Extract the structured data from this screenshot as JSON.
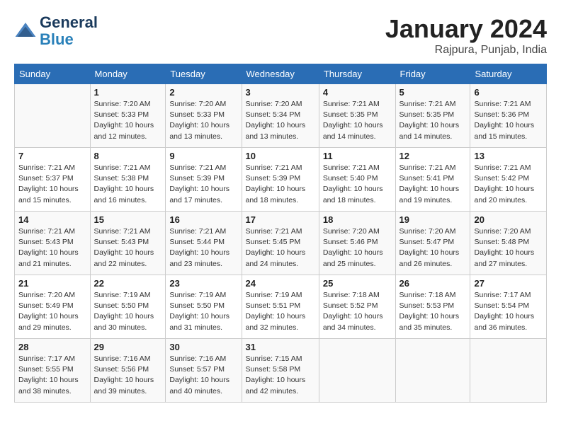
{
  "header": {
    "logo_line1": "General",
    "logo_line2": "Blue",
    "month": "January 2024",
    "location": "Rajpura, Punjab, India"
  },
  "weekdays": [
    "Sunday",
    "Monday",
    "Tuesday",
    "Wednesday",
    "Thursday",
    "Friday",
    "Saturday"
  ],
  "weeks": [
    [
      {
        "day": "",
        "sunrise": "",
        "sunset": "",
        "daylight": ""
      },
      {
        "day": "1",
        "sunrise": "Sunrise: 7:20 AM",
        "sunset": "Sunset: 5:33 PM",
        "daylight": "Daylight: 10 hours and 12 minutes."
      },
      {
        "day": "2",
        "sunrise": "Sunrise: 7:20 AM",
        "sunset": "Sunset: 5:33 PM",
        "daylight": "Daylight: 10 hours and 13 minutes."
      },
      {
        "day": "3",
        "sunrise": "Sunrise: 7:20 AM",
        "sunset": "Sunset: 5:34 PM",
        "daylight": "Daylight: 10 hours and 13 minutes."
      },
      {
        "day": "4",
        "sunrise": "Sunrise: 7:21 AM",
        "sunset": "Sunset: 5:35 PM",
        "daylight": "Daylight: 10 hours and 14 minutes."
      },
      {
        "day": "5",
        "sunrise": "Sunrise: 7:21 AM",
        "sunset": "Sunset: 5:35 PM",
        "daylight": "Daylight: 10 hours and 14 minutes."
      },
      {
        "day": "6",
        "sunrise": "Sunrise: 7:21 AM",
        "sunset": "Sunset: 5:36 PM",
        "daylight": "Daylight: 10 hours and 15 minutes."
      }
    ],
    [
      {
        "day": "7",
        "sunrise": "Sunrise: 7:21 AM",
        "sunset": "Sunset: 5:37 PM",
        "daylight": "Daylight: 10 hours and 15 minutes."
      },
      {
        "day": "8",
        "sunrise": "Sunrise: 7:21 AM",
        "sunset": "Sunset: 5:38 PM",
        "daylight": "Daylight: 10 hours and 16 minutes."
      },
      {
        "day": "9",
        "sunrise": "Sunrise: 7:21 AM",
        "sunset": "Sunset: 5:39 PM",
        "daylight": "Daylight: 10 hours and 17 minutes."
      },
      {
        "day": "10",
        "sunrise": "Sunrise: 7:21 AM",
        "sunset": "Sunset: 5:39 PM",
        "daylight": "Daylight: 10 hours and 18 minutes."
      },
      {
        "day": "11",
        "sunrise": "Sunrise: 7:21 AM",
        "sunset": "Sunset: 5:40 PM",
        "daylight": "Daylight: 10 hours and 18 minutes."
      },
      {
        "day": "12",
        "sunrise": "Sunrise: 7:21 AM",
        "sunset": "Sunset: 5:41 PM",
        "daylight": "Daylight: 10 hours and 19 minutes."
      },
      {
        "day": "13",
        "sunrise": "Sunrise: 7:21 AM",
        "sunset": "Sunset: 5:42 PM",
        "daylight": "Daylight: 10 hours and 20 minutes."
      }
    ],
    [
      {
        "day": "14",
        "sunrise": "Sunrise: 7:21 AM",
        "sunset": "Sunset: 5:43 PM",
        "daylight": "Daylight: 10 hours and 21 minutes."
      },
      {
        "day": "15",
        "sunrise": "Sunrise: 7:21 AM",
        "sunset": "Sunset: 5:43 PM",
        "daylight": "Daylight: 10 hours and 22 minutes."
      },
      {
        "day": "16",
        "sunrise": "Sunrise: 7:21 AM",
        "sunset": "Sunset: 5:44 PM",
        "daylight": "Daylight: 10 hours and 23 minutes."
      },
      {
        "day": "17",
        "sunrise": "Sunrise: 7:21 AM",
        "sunset": "Sunset: 5:45 PM",
        "daylight": "Daylight: 10 hours and 24 minutes."
      },
      {
        "day": "18",
        "sunrise": "Sunrise: 7:20 AM",
        "sunset": "Sunset: 5:46 PM",
        "daylight": "Daylight: 10 hours and 25 minutes."
      },
      {
        "day": "19",
        "sunrise": "Sunrise: 7:20 AM",
        "sunset": "Sunset: 5:47 PM",
        "daylight": "Daylight: 10 hours and 26 minutes."
      },
      {
        "day": "20",
        "sunrise": "Sunrise: 7:20 AM",
        "sunset": "Sunset: 5:48 PM",
        "daylight": "Daylight: 10 hours and 27 minutes."
      }
    ],
    [
      {
        "day": "21",
        "sunrise": "Sunrise: 7:20 AM",
        "sunset": "Sunset: 5:49 PM",
        "daylight": "Daylight: 10 hours and 29 minutes."
      },
      {
        "day": "22",
        "sunrise": "Sunrise: 7:19 AM",
        "sunset": "Sunset: 5:50 PM",
        "daylight": "Daylight: 10 hours and 30 minutes."
      },
      {
        "day": "23",
        "sunrise": "Sunrise: 7:19 AM",
        "sunset": "Sunset: 5:50 PM",
        "daylight": "Daylight: 10 hours and 31 minutes."
      },
      {
        "day": "24",
        "sunrise": "Sunrise: 7:19 AM",
        "sunset": "Sunset: 5:51 PM",
        "daylight": "Daylight: 10 hours and 32 minutes."
      },
      {
        "day": "25",
        "sunrise": "Sunrise: 7:18 AM",
        "sunset": "Sunset: 5:52 PM",
        "daylight": "Daylight: 10 hours and 34 minutes."
      },
      {
        "day": "26",
        "sunrise": "Sunrise: 7:18 AM",
        "sunset": "Sunset: 5:53 PM",
        "daylight": "Daylight: 10 hours and 35 minutes."
      },
      {
        "day": "27",
        "sunrise": "Sunrise: 7:17 AM",
        "sunset": "Sunset: 5:54 PM",
        "daylight": "Daylight: 10 hours and 36 minutes."
      }
    ],
    [
      {
        "day": "28",
        "sunrise": "Sunrise: 7:17 AM",
        "sunset": "Sunset: 5:55 PM",
        "daylight": "Daylight: 10 hours and 38 minutes."
      },
      {
        "day": "29",
        "sunrise": "Sunrise: 7:16 AM",
        "sunset": "Sunset: 5:56 PM",
        "daylight": "Daylight: 10 hours and 39 minutes."
      },
      {
        "day": "30",
        "sunrise": "Sunrise: 7:16 AM",
        "sunset": "Sunset: 5:57 PM",
        "daylight": "Daylight: 10 hours and 40 minutes."
      },
      {
        "day": "31",
        "sunrise": "Sunrise: 7:15 AM",
        "sunset": "Sunset: 5:58 PM",
        "daylight": "Daylight: 10 hours and 42 minutes."
      },
      {
        "day": "",
        "sunrise": "",
        "sunset": "",
        "daylight": ""
      },
      {
        "day": "",
        "sunrise": "",
        "sunset": "",
        "daylight": ""
      },
      {
        "day": "",
        "sunrise": "",
        "sunset": "",
        "daylight": ""
      }
    ]
  ]
}
